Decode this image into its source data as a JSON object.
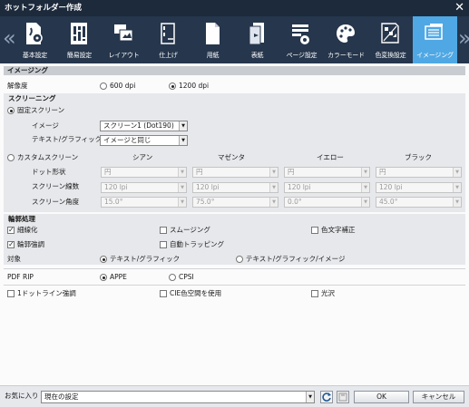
{
  "window": {
    "title": "ホットフォルダー作成"
  },
  "tabs": [
    {
      "label": "基本設定",
      "icon": "basic-settings-icon"
    },
    {
      "label": "簡易設定",
      "icon": "easy-settings-icon"
    },
    {
      "label": "レイアウト",
      "icon": "layout-icon"
    },
    {
      "label": "仕上げ",
      "icon": "finishing-icon"
    },
    {
      "label": "用紙",
      "icon": "paper-icon"
    },
    {
      "label": "表紙",
      "icon": "cover-icon"
    },
    {
      "label": "ページ設定",
      "icon": "page-settings-icon"
    },
    {
      "label": "カラーモード",
      "icon": "color-mode-icon"
    },
    {
      "label": "色変換設定",
      "icon": "color-conversion-icon"
    },
    {
      "label": "イメージング",
      "icon": "imaging-icon"
    }
  ],
  "imaging": {
    "section_title": "イメージング",
    "resolution_label": "解像度",
    "res_600": "600 dpi",
    "res_1200": "1200 dpi",
    "resolution_selected": "1200 dpi"
  },
  "screening": {
    "title": "スクリーニング",
    "fixed_label": "固定スクリーン",
    "image_label": "イメージ",
    "image_value": "スクリーン1 (Dot190)",
    "text_label": "テキスト/グラフィック",
    "text_value": "イメージと同じ",
    "custom_label": "カスタムスクリーン",
    "col_cyan": "シアン",
    "col_magenta": "マゼンタ",
    "col_yellow": "イエロー",
    "col_black": "ブラック",
    "row_dot": "ドット形状",
    "row_lpi": "スクリーン線数",
    "row_angle": "スクリーン角度",
    "dot_values": [
      "円",
      "円",
      "円",
      "円"
    ],
    "lpi_values": [
      "120 lpi",
      "120 lpi",
      "120 lpi",
      "120 lpi"
    ],
    "angle_values": [
      "15.0°",
      "75.0°",
      "0.0°",
      "45.0°"
    ]
  },
  "edge": {
    "title": "輪郭処理",
    "thinning": "細線化",
    "smoothing": "スムージング",
    "color_char": "色文字補正",
    "edge_enhance": "輪郭強調",
    "auto_trap": "自動トラッピング",
    "target_label": "対象",
    "target_text": "テキスト/グラフィック",
    "target_all": "テキスト/グラフィック/イメージ"
  },
  "pdf": {
    "label": "PDF RIP",
    "appe": "APPE",
    "cpsi": "CPSI",
    "one_dot": "1ドットライン強調",
    "cie": "CIE色空間を使用",
    "gloss": "光沢"
  },
  "footer": {
    "favorites_label": "お気に入り",
    "favorites_value": "現在の設定",
    "ok": "OK",
    "cancel": "キャンセル"
  }
}
